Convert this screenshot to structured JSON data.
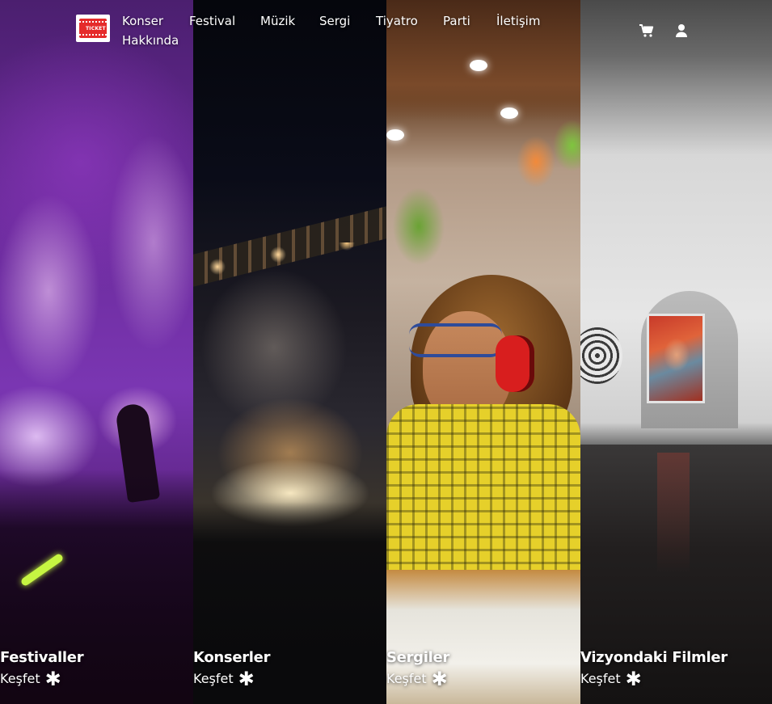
{
  "logo": {
    "text": "TICKET"
  },
  "nav": {
    "items": [
      "Konser",
      "Festival",
      "Müzik",
      "Sergi",
      "Tiyatro",
      "Parti",
      "İletişim",
      "Hakkında"
    ]
  },
  "header_icons": [
    "cart-icon",
    "user-icon"
  ],
  "panels": [
    {
      "title": "Festivaller",
      "cta": "Keşfet"
    },
    {
      "title": "Konserler",
      "cta": "Keşfet"
    },
    {
      "title": "Sergiler",
      "cta": "Keşfet"
    },
    {
      "title": "Vizyondaki Filmler",
      "cta": "Keşfet"
    }
  ],
  "colors": {
    "logo_red": "#e52b2b",
    "text": "#ffffff"
  }
}
